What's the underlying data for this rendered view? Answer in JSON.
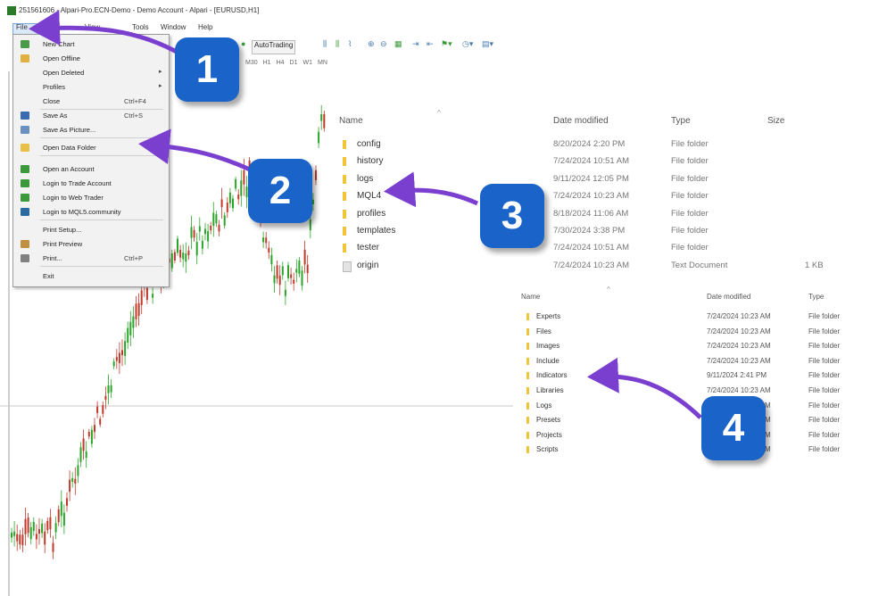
{
  "title_bar": {
    "text": "251561606 - Alpari-Pro.ECN-Demo - Demo Account - Alpari - [EURUSD,H1]"
  },
  "menu_bar": {
    "file": "File",
    "view": "View",
    "tools": "Tools",
    "window": "Window",
    "help": "Help"
  },
  "toolbar": {
    "autotrading": "AutoTrading"
  },
  "timeframes": [
    "M30",
    "H1",
    "H4",
    "D1",
    "W1",
    "MN"
  ],
  "file_menu": [
    {
      "label": "New Chart",
      "shortcut": "",
      "arrow": "",
      "icon": "new-chart-icon",
      "color": "#4a9a4a"
    },
    {
      "label": "Open Offline",
      "shortcut": "",
      "arrow": "",
      "icon": "open-offline-icon",
      "color": "#e0b040"
    },
    {
      "label": "Open Deleted",
      "shortcut": "",
      "arrow": "▸",
      "icon": "",
      "color": ""
    },
    {
      "label": "Profiles",
      "shortcut": "",
      "arrow": "▸",
      "icon": "",
      "color": ""
    },
    {
      "label": "Close",
      "shortcut": "Ctrl+F4",
      "arrow": "",
      "icon": "",
      "color": ""
    },
    {
      "label": "Save As",
      "shortcut": "Ctrl+S",
      "arrow": "",
      "icon": "save-icon",
      "color": "#3a6ab0"
    },
    {
      "label": "Save As Picture...",
      "shortcut": "",
      "arrow": "",
      "icon": "picture-icon",
      "color": "#6a90c0"
    },
    {
      "label": "Open Data Folder",
      "shortcut": "",
      "arrow": "",
      "icon": "folder-icon",
      "color": "#e8c048"
    },
    {
      "label": "Open an Account",
      "shortcut": "",
      "arrow": "",
      "icon": "account-icon",
      "color": "#3a9a3a"
    },
    {
      "label": "Login to Trade Account",
      "shortcut": "",
      "arrow": "",
      "icon": "login-icon",
      "color": "#3a9a3a"
    },
    {
      "label": "Login to Web Trader",
      "shortcut": "",
      "arrow": "",
      "icon": "web-trader-icon",
      "color": "#3a9a3a"
    },
    {
      "label": "Login to MQL5.community",
      "shortcut": "",
      "arrow": "",
      "icon": "mql5-icon",
      "color": "#2a6aa0"
    },
    {
      "label": "Print Setup...",
      "shortcut": "",
      "arrow": "",
      "icon": "",
      "color": ""
    },
    {
      "label": "Print Preview",
      "shortcut": "",
      "arrow": "",
      "icon": "print-preview-icon",
      "color": "#c09040"
    },
    {
      "label": "Print...",
      "shortcut": "Ctrl+P",
      "arrow": "",
      "icon": "print-icon",
      "color": "#808080"
    },
    {
      "label": "Exit",
      "shortcut": "",
      "arrow": "",
      "icon": "",
      "color": ""
    }
  ],
  "explorer1": {
    "headers": {
      "name": "Name",
      "date": "Date modified",
      "type": "Type",
      "size": "Size"
    },
    "rows": [
      {
        "name": "config",
        "date": "8/20/2024 2:20 PM",
        "type": "File folder",
        "size": ""
      },
      {
        "name": "history",
        "date": "7/24/2024 10:51 AM",
        "type": "File folder",
        "size": ""
      },
      {
        "name": "logs",
        "date": "9/11/2024 12:05 PM",
        "type": "File folder",
        "size": ""
      },
      {
        "name": "MQL4",
        "date": "7/24/2024 10:23 AM",
        "type": "File folder",
        "size": ""
      },
      {
        "name": "profiles",
        "date": "8/18/2024 11:06 AM",
        "type": "File folder",
        "size": ""
      },
      {
        "name": "templates",
        "date": "7/30/2024 3:38 PM",
        "type": "File folder",
        "size": ""
      },
      {
        "name": "tester",
        "date": "7/24/2024 10:51 AM",
        "type": "File folder",
        "size": ""
      },
      {
        "name": "origin",
        "date": "7/24/2024 10:23 AM",
        "type": "Text Document",
        "size": "1 KB"
      }
    ]
  },
  "explorer2": {
    "headers": {
      "name": "Name",
      "date": "Date modified",
      "type": "Type"
    },
    "rows": [
      {
        "name": "Experts",
        "date": "7/24/2024 10:23 AM",
        "type": "File folder"
      },
      {
        "name": "Files",
        "date": "7/24/2024 10:23 AM",
        "type": "File folder"
      },
      {
        "name": "Images",
        "date": "7/24/2024 10:23 AM",
        "type": "File folder"
      },
      {
        "name": "Include",
        "date": "7/24/2024 10:23 AM",
        "type": "File folder"
      },
      {
        "name": "Indicators",
        "date": "9/11/2024 2:41 PM",
        "type": "File folder"
      },
      {
        "name": "Libraries",
        "date": "7/24/2024 10:23 AM",
        "type": "File folder"
      },
      {
        "name": "Logs",
        "date": "7/24/2024 10:23 AM",
        "type": "File folder"
      },
      {
        "name": "Presets",
        "date": "7/24/2024 10:23 AM",
        "type": "File folder"
      },
      {
        "name": "Projects",
        "date": "7/24/2024 10:23 AM",
        "type": "File folder"
      },
      {
        "name": "Scripts",
        "date": "7/24/2024 10:23 AM",
        "type": "File folder"
      }
    ]
  },
  "badges": [
    "1",
    "2",
    "3",
    "4"
  ],
  "colors": {
    "badge": "#1a63c9",
    "arrow": "#7b3fd0",
    "bull": "#2aa52a",
    "bear": "#c0392b"
  }
}
